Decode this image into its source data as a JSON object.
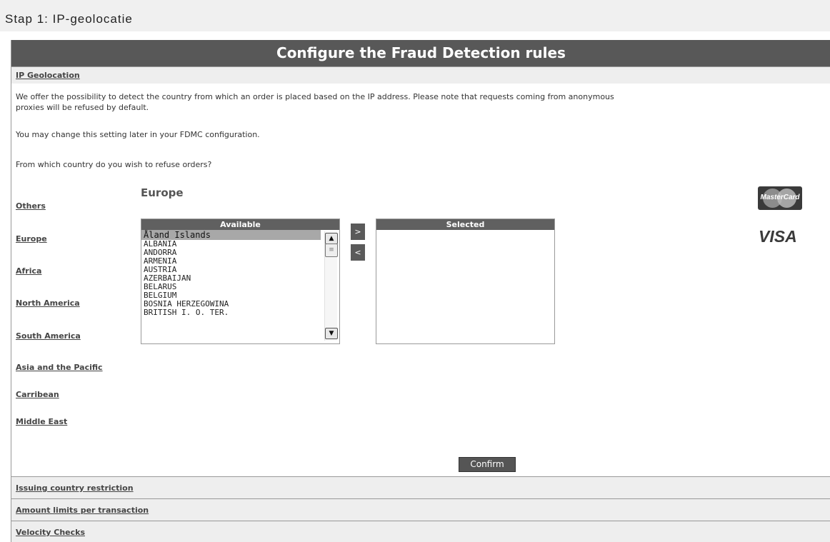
{
  "step": {
    "title": "Stap 1: IP-geolocatie"
  },
  "panel": {
    "title": "Configure the Fraud Detection rules"
  },
  "sections": {
    "ip_geolocation": "IP Geolocation",
    "issuing_country": "Issuing country restriction",
    "amount_limits": "Amount limits per transaction",
    "velocity_checks": "Velocity Checks"
  },
  "intro": {
    "line1": "We offer the possibility to detect the country from which an order is placed based on the IP address. Please note that requests coming from anonymous",
    "line2": "proxies will be refused by default.",
    "line3": "You may change this setting later in your FDMC configuration.",
    "question": "From which country do you wish to refuse orders?"
  },
  "regions": [
    "Others",
    "Europe",
    "Africa",
    "North America",
    "South America",
    "Asia and the Pacific",
    "Carribean",
    "Middle East"
  ],
  "current_region": "Europe",
  "available": {
    "header": "Available",
    "items": [
      "Åland Islands",
      "ALBANIA",
      "ANDORRA",
      "ARMENIA",
      "AUSTRIA",
      "AZERBAIJAN",
      "BELARUS",
      "BELGIUM",
      "BOSNIA HERZEGOWINA",
      "BRITISH I. O. TER."
    ],
    "selected_item": "Åland Islands"
  },
  "selected": {
    "header": "Selected",
    "items": []
  },
  "buttons": {
    "add": ">",
    "remove": "<",
    "confirm": "Confirm"
  },
  "scrollbar": {
    "up": "▲",
    "down": "▼",
    "thumb": "≡"
  },
  "logos": {
    "mastercard": "MasterCard",
    "visa": "VISA"
  },
  "colors": {
    "header_bg": "#585858",
    "section_bg": "#eeeeee",
    "button_bg": "#555555"
  }
}
